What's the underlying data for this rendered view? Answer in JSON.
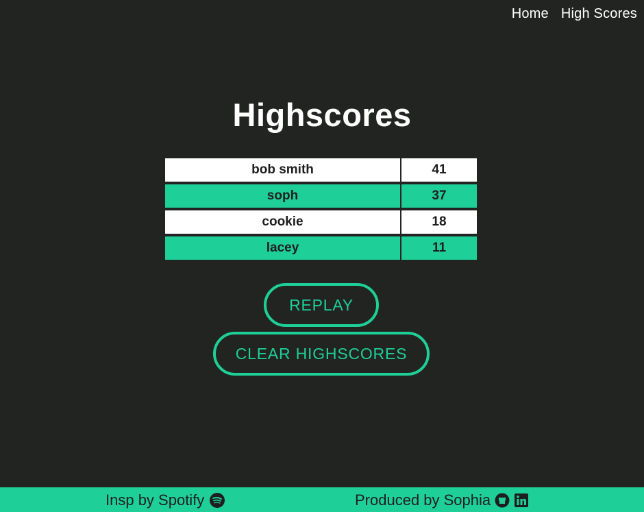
{
  "nav": {
    "home": "Home",
    "high_scores": "High Scores"
  },
  "page": {
    "title": "Highscores"
  },
  "scores": [
    {
      "name": "bob smith",
      "score": "41"
    },
    {
      "name": "soph",
      "score": "37"
    },
    {
      "name": "cookie",
      "score": "18"
    },
    {
      "name": "lacey",
      "score": "11"
    }
  ],
  "buttons": {
    "replay": "REPLAY",
    "clear": "CLEAR HIGHSCORES"
  },
  "footer": {
    "inspired": "Insp by Spotify",
    "produced": "Produced by Sophia"
  },
  "colors": {
    "background": "#222422",
    "accent": "#1fcf98",
    "row_light": "#ffffff"
  },
  "icons": [
    "spotify-icon",
    "github-icon",
    "linkedin-icon"
  ]
}
